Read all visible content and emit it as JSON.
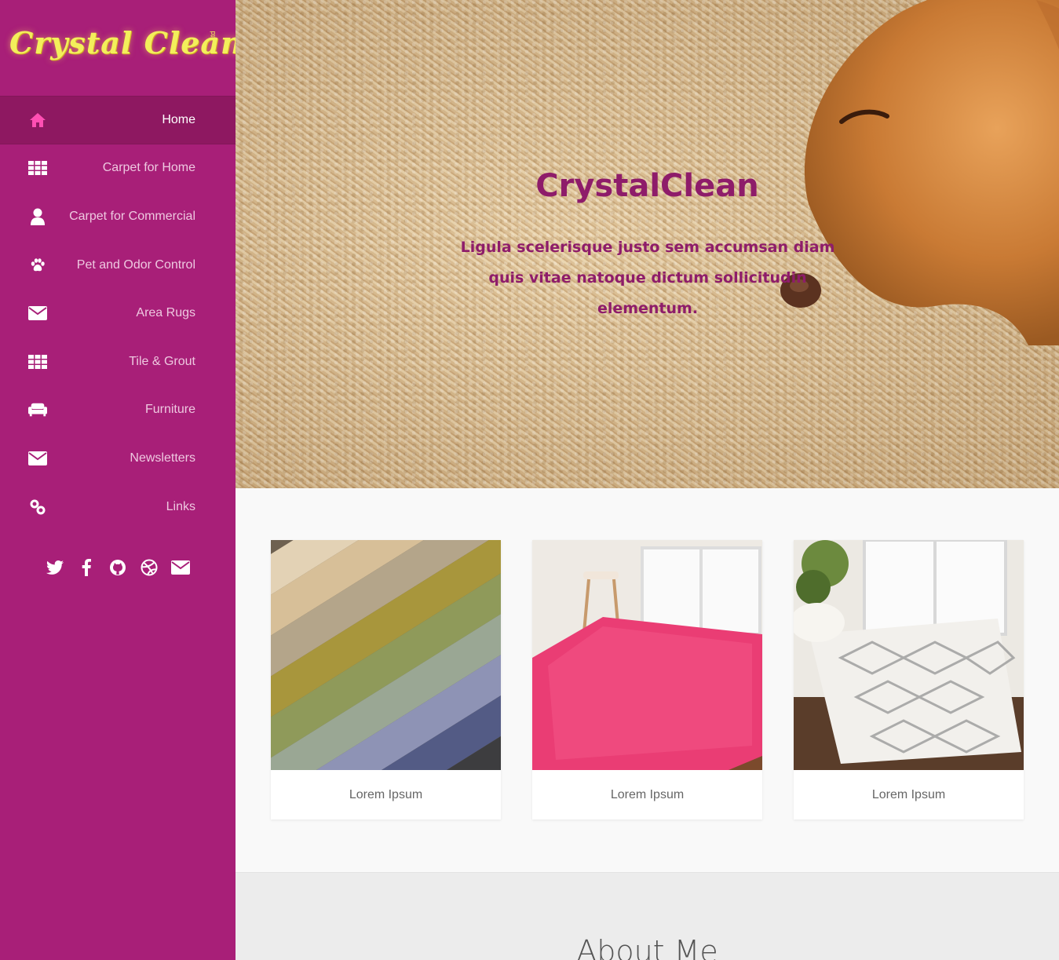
{
  "logo": {
    "text": "Crystal Clean",
    "suffix": "Ltd"
  },
  "nav": {
    "items": [
      {
        "label": "Home",
        "icon": "home-icon",
        "active": true
      },
      {
        "label": "Carpet for Home",
        "icon": "grid-icon"
      },
      {
        "label": "Carpet for Commercial",
        "icon": "user-icon"
      },
      {
        "label": "Pet and Odor Control",
        "icon": "paw-icon"
      },
      {
        "label": "Area Rugs",
        "icon": "envelope-icon"
      },
      {
        "label": "Tile & Grout",
        "icon": "grid-icon"
      },
      {
        "label": "Furniture",
        "icon": "sofa-icon"
      },
      {
        "label": "Newsletters",
        "icon": "envelope-icon"
      },
      {
        "label": "Links",
        "icon": "link-icon"
      }
    ]
  },
  "social": [
    "twitter-icon",
    "facebook-icon",
    "github-icon",
    "dribbble-icon",
    "envelope-icon"
  ],
  "hero": {
    "title": "CrystalClean",
    "subtitle": "Ligula scelerisque justo sem accumsan diam quis vitae natoque dictum sollicitudin elementum."
  },
  "cards": [
    {
      "label": "Lorem Ipsum"
    },
    {
      "label": "Lorem Ipsum"
    },
    {
      "label": "Lorem Ipsum"
    }
  ],
  "about": {
    "title": "About Me"
  },
  "colors": {
    "sidebar": "#a81f78",
    "active_nav": "#8e1861",
    "hero_text": "#8e1c6a",
    "logo": "#f3ef5b",
    "accent_icon": "#ff4fb3"
  }
}
